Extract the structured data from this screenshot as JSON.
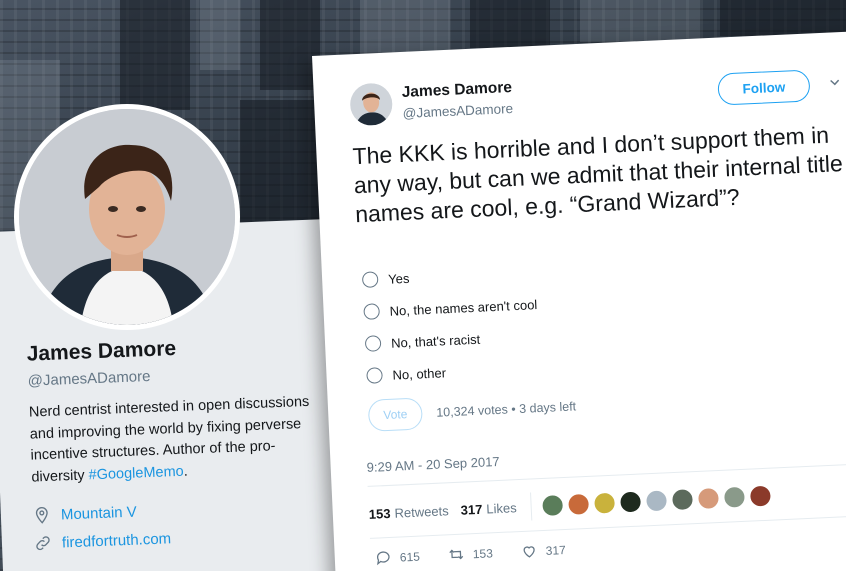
{
  "profile": {
    "name": "James Damore",
    "handle": "@JamesADamore",
    "bio_text": "Nerd centrist interested in open discussions and improving the world by fixing perverse incentive structures. Author of the pro-diversity",
    "bio_hashtag": "#GoogleMemo",
    "bio_end": ".",
    "location": "Mountain V",
    "website": "firedfortruth.com",
    "icons": {
      "location": "location-pin-icon",
      "link": "link-icon"
    }
  },
  "tweet": {
    "author_name": "James Damore",
    "author_handle": "@JamesADamore",
    "follow_label": "Follow",
    "text": "The KKK is horrible and I don’t support them in any way, but can we admit that their internal title names are cool, e.g. “Grand Wizard”?",
    "poll": {
      "options": [
        "Yes",
        "No, the names aren't cool",
        "No, that's racist",
        "No, other"
      ],
      "vote_label": "Vote",
      "votes": "10,324 votes",
      "separator": "•",
      "time_left": "3 days left"
    },
    "timestamp": "9:29 AM - 20 Sep 2017",
    "stats": {
      "retweets_count": "153",
      "retweets_label": "Retweets",
      "likes_count": "317",
      "likes_label": "Likes"
    },
    "actions": {
      "replies": "615",
      "retweets": "153",
      "likes": "317"
    }
  },
  "colors": {
    "accent": "#1da1f2",
    "text": "#14171a",
    "muted": "#657786"
  }
}
